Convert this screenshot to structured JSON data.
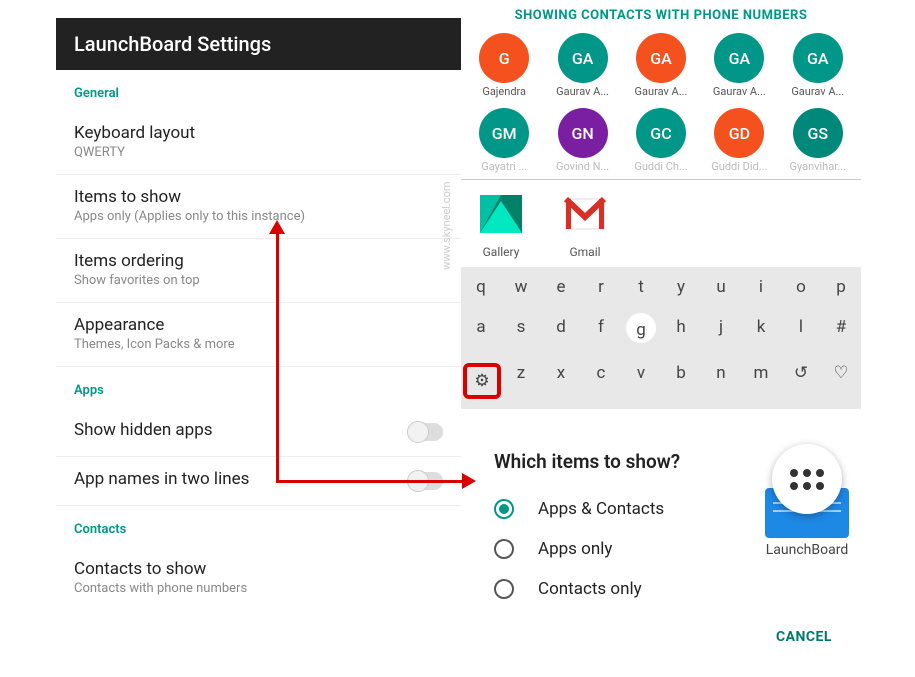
{
  "settings": {
    "title": "LaunchBoard Settings",
    "sections": {
      "general": {
        "label": "General",
        "keyboard_layout": {
          "title": "Keyboard layout",
          "sub": "QWERTY"
        },
        "items_to_show": {
          "title": "Items to show",
          "sub": "Apps only (Applies only to this instance)"
        },
        "items_ordering": {
          "title": "Items ordering",
          "sub": "Show favorites on top"
        },
        "appearance": {
          "title": "Appearance",
          "sub": "Themes, Icon Packs & more"
        }
      },
      "apps": {
        "label": "Apps",
        "show_hidden": {
          "title": "Show hidden apps"
        },
        "two_lines": {
          "title": "App names in two lines"
        }
      },
      "contacts": {
        "label": "Contacts",
        "to_show": {
          "title": "Contacts to show",
          "sub": "Contacts with phone numbers"
        }
      }
    }
  },
  "contacts_header": "SHOWING CONTACTS WITH PHONE NUMBERS",
  "contacts_row1": [
    {
      "initials": "G",
      "name": "Gajendra",
      "color": "av-orange"
    },
    {
      "initials": "GA",
      "name": "Gaurav A...",
      "color": "av-teal"
    },
    {
      "initials": "GA",
      "name": "Gaurav A...",
      "color": "av-orange"
    },
    {
      "initials": "GA",
      "name": "Gaurav A...",
      "color": "av-teal"
    },
    {
      "initials": "GA",
      "name": "Gaurav A...",
      "color": "av-teal"
    }
  ],
  "contacts_row2": [
    {
      "initials": "GM",
      "name": "Gayatri ...",
      "color": "av-teal"
    },
    {
      "initials": "GN",
      "name": "Govind N...",
      "color": "av-purple"
    },
    {
      "initials": "GC",
      "name": "Guddi Ch...",
      "color": "av-teal"
    },
    {
      "initials": "GD",
      "name": "Guddi Did...",
      "color": "av-orange"
    },
    {
      "initials": "GS",
      "name": "Gyanvihar...",
      "color": "av-green"
    }
  ],
  "apps": [
    {
      "name": "Gallery"
    },
    {
      "name": "Gmail"
    }
  ],
  "keyboard": {
    "row1": [
      "q",
      "w",
      "e",
      "r",
      "t",
      "y",
      "u",
      "i",
      "o",
      "p"
    ],
    "row2": [
      "a",
      "s",
      "d",
      "f",
      "g",
      "h",
      "j",
      "k",
      "l",
      "#"
    ],
    "row3": [
      "⚙",
      "z",
      "x",
      "c",
      "v",
      "b",
      "n",
      "m",
      "↺",
      "♡"
    ]
  },
  "dialog": {
    "title": "Which items to show?",
    "options": [
      "Apps & Contacts",
      "Apps only",
      "Contacts only"
    ],
    "selected": 0,
    "cancel": "CANCEL"
  },
  "launchboard_label": "LaunchBoard",
  "watermark": "www.skyneel.com"
}
